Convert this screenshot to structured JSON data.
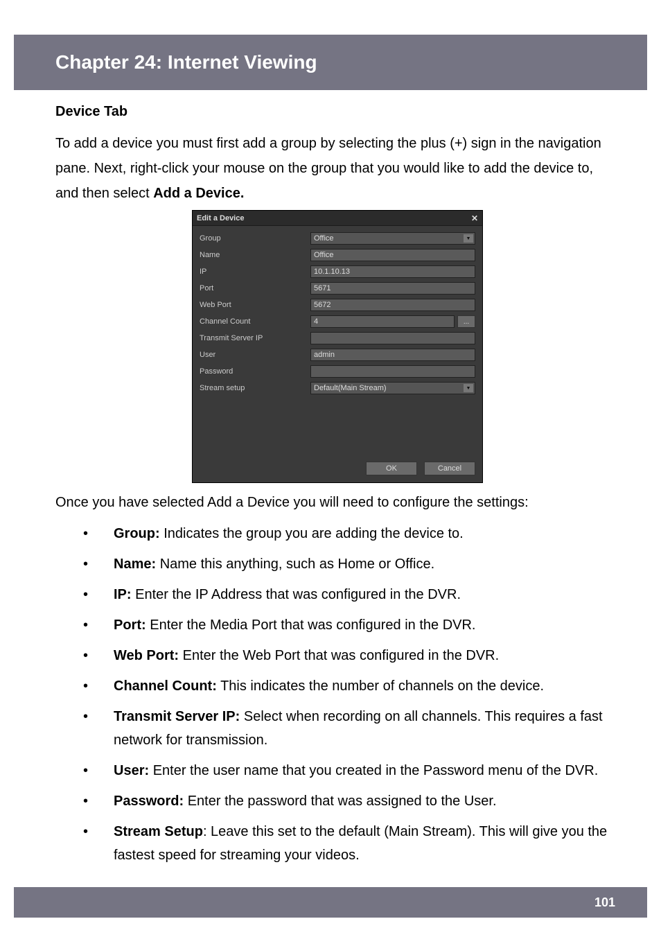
{
  "header": {
    "title": "Chapter 24: Internet Viewing"
  },
  "section": {
    "heading": "Device Tab"
  },
  "intro": {
    "p1a": "To add a device you must first add a group by selecting the plus (+) sign in the navigation pane. Next, right-click your mouse on the group that you would like to add the device to, and then select ",
    "p1b": "Add a Device."
  },
  "dialog": {
    "title": "Edit a Device",
    "close_glyph": "✕",
    "fields": {
      "group": {
        "label": "Group",
        "value": "Office",
        "type": "dropdown"
      },
      "name": {
        "label": "Name",
        "value": "Office",
        "type": "text"
      },
      "ip": {
        "label": "IP",
        "value": "10.1.10.13",
        "type": "text"
      },
      "port": {
        "label": "Port",
        "value": "5671",
        "type": "text"
      },
      "webport": {
        "label": "Web Port",
        "value": "5672",
        "type": "text"
      },
      "chcount": {
        "label": "Channel Count",
        "value": "4",
        "type": "text-ellipsis"
      },
      "tserver": {
        "label": "Transmit Server IP",
        "value": "",
        "type": "text"
      },
      "user": {
        "label": "User",
        "value": "admin",
        "type": "text"
      },
      "password": {
        "label": "Password",
        "value": "",
        "type": "text"
      },
      "stream": {
        "label": "Stream setup",
        "value": "Default(Main Stream)",
        "type": "dropdown"
      }
    },
    "buttons": {
      "ok": "OK",
      "cancel": "Cancel",
      "ellipsis": "..."
    }
  },
  "after": "Once you have selected Add a Device you will need to configure the settings:",
  "defs": [
    {
      "term": "Group:",
      "text": " Indicates the group you are adding the device to."
    },
    {
      "term": "Name:",
      "text": " Name this anything, such as Home or Office."
    },
    {
      "term": "IP:",
      "text": " Enter the IP Address that was configured in the DVR."
    },
    {
      "term": "Port:",
      "text": " Enter the Media Port that was configured in the DVR."
    },
    {
      "term": "Web Port:",
      "text": " Enter the Web Port that was configured in the DVR."
    },
    {
      "term": "Channel Count:",
      "text": " This indicates the number of channels on the device."
    },
    {
      "term": "Transmit Server IP:",
      "text": " Select when recording on all channels. This requires a fast network for transmission."
    },
    {
      "term": "User:",
      "text": " Enter the user name that you created in the Password menu of the DVR."
    },
    {
      "term": "Password:",
      "text": " Enter the password that was assigned to the User."
    },
    {
      "term": "Stream Setup",
      "text": ": Leave this set to the default (Main Stream). This will give you the fastest speed for streaming your videos."
    }
  ],
  "footer": {
    "page_number": "101"
  }
}
